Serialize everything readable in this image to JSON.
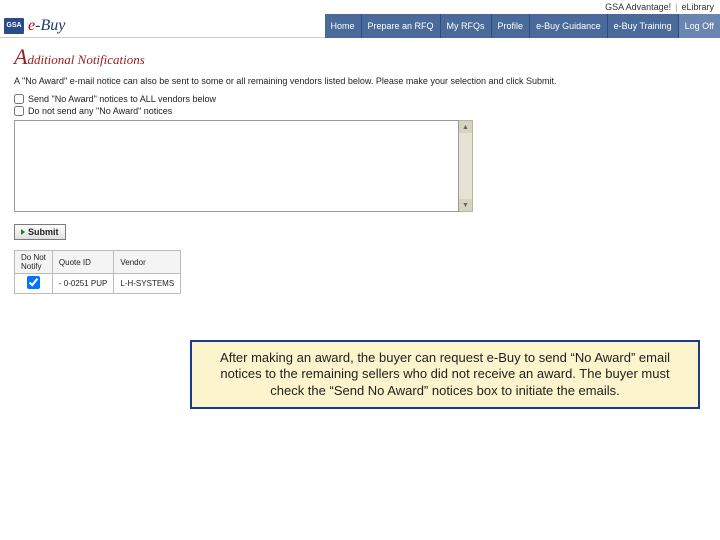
{
  "toplinks": {
    "gsaadv": "GSA Advantage!",
    "elibrary": "eLibrary"
  },
  "brand": {
    "gsa": "GSA",
    "e": "e",
    "buy": "-Buy"
  },
  "nav": {
    "home": "Home",
    "prepare": "Prepare an RFQ",
    "myrfqs": "My RFQs",
    "profile": "Profile",
    "guidance": "e-Buy Guidance",
    "training": "e-Buy Training",
    "logoff": "Log Off"
  },
  "section": {
    "bigletter": "A",
    "rest": "dditional Notifications"
  },
  "instruction": "A \"No Award\" e-mail notice can also be sent to some or all remaining vendors listed below. Please make your selection and click Submit.",
  "checks": {
    "send_all": "Send \"No Award\" notices to ALL vendors below",
    "send_none": "Do not send any \"No Award\" notices"
  },
  "textarea_value": "",
  "submit_label": "Submit",
  "table": {
    "headers": {
      "notify": "Do Not\nNotify",
      "quote": "Quote ID",
      "vendor": "Vendor"
    },
    "rows": [
      {
        "notify_checked": true,
        "quote_id": "- 0-0251 PUP",
        "vendor": "L-H-SYSTEMS"
      }
    ]
  },
  "annotation": "After making an award, the buyer can request e-Buy to send “No Award” email notices to the remaining sellers who did not receive an award.  The buyer must check the “Send No Award” notices box to initiate the emails."
}
